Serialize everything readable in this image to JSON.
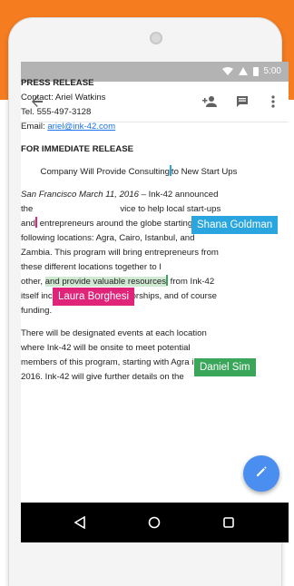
{
  "status_bar": {
    "time": "5:00"
  },
  "document": {
    "heading": "PRESS RELEASE",
    "contact": "Contact: Ariel Watkins",
    "tel": "Tel. 555-497-3128",
    "email_label": "Email: ",
    "email_link": "ariel@ink-42.com",
    "release": "FOR IMMEDIATE RELEASE",
    "subtitle_a": "Company Will Provide Consulting",
    "subtitle_b": "to New Start Ups",
    "dateline": "San Francisco March 11, 2016",
    "p1_l1_rest": " – Ink-42 announced",
    "p1_l2_a": "the",
    "p1_l2_b": "vice to help local start-ups",
    "p1_l3_a": "and",
    "p1_l3_b": "entrepreneurs around the globe starting in the",
    "p1_l4": "following locations: Agra, Cairo, Istanbul, and",
    "p1_l5": "Zambia. This program will bring entrepreneurs from",
    "p1_l6": "these different locations together to l",
    "p1_l7_a": "other, ",
    "p1_l7_b": "and provide valuable resources",
    "p1_l7_c": " from Ink-42",
    "p1_l8": "itself including classes, mentorships, and of course",
    "p1_l9": "funding.",
    "p2_l1": "There will be designated events at each location",
    "p2_l2": "where Ink-42 will be onsite to meet potential",
    "p2_l3": "members of this program, starting with Agra in",
    "p2_l4": "2016. Ink-42 will give further details on the"
  },
  "collaborators": [
    {
      "name": "Shana Goldman",
      "color": "#29a6df"
    },
    {
      "name": "Laura Borghesi",
      "color": "#e0247a"
    },
    {
      "name": "Daniel Sim",
      "color": "#3aa65a"
    }
  ],
  "icons": [
    "back-arrow-icon",
    "add-person-icon",
    "comment-icon",
    "more-vert-icon",
    "edit-pencil-icon",
    "nav-back-icon",
    "nav-home-icon",
    "nav-recents-icon"
  ]
}
